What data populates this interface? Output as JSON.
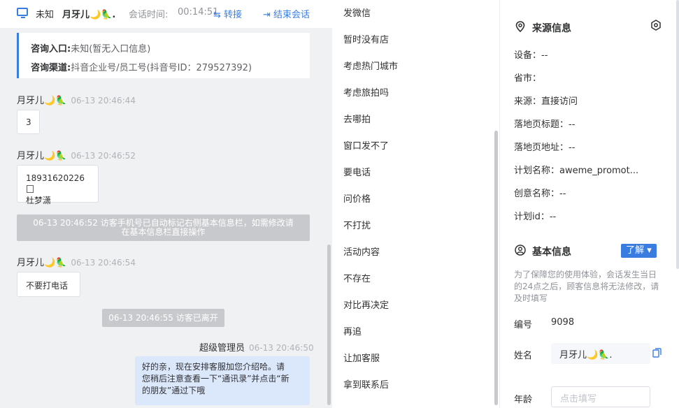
{
  "header": {
    "source": "未知",
    "name": "月牙儿🌙🦜.",
    "time_label": "会话时间:",
    "time": "00:14:51",
    "transfer": "⇆ 转接",
    "end": "⇥ 结束会话"
  },
  "consult": {
    "entry_label": "咨询入口:",
    "entry_value": "未知(暂无入口信息)",
    "channel_label": "咨询渠道:",
    "channel_value": "抖音企业号/员工号(抖音号ID：279527392)"
  },
  "messages": [
    {
      "sender": "月牙儿🌙🦜",
      "time": "06-13 20:46:44",
      "text": "3"
    },
    {
      "sender": "月牙儿🌙🦜",
      "time": "06-13 20:46:52",
      "line1": "18931620226",
      "line2": "杜梦潇"
    },
    {
      "sender": "月牙儿🌙🦜",
      "time": "06-13 20:46:54",
      "text": "不要打电话"
    }
  ],
  "system": [
    {
      "line1": "06-13 20:46:52 访客手机号已自动标记右侧基本信息栏，如需修改请",
      "line2": "在基本信息栏直接操作"
    },
    {
      "line1": "06-13 20:46:55 访客已离开"
    }
  ],
  "agent": {
    "sender": "超级管理员",
    "time": "06-13 20:46:50",
    "line1": "好的亲，现在安排客服加您介绍哈。请",
    "line2": "您稍后注意查看一下“通讯录”并点击“新",
    "line3": "的朋友”通过下哦"
  },
  "quick_replies": [
    "发微信",
    "暂时没有店",
    "考虑热门城市",
    "考虑旅拍吗",
    "去哪拍",
    "窗口发不了",
    "要电话",
    "问价格",
    "不打扰",
    "活动内容",
    "不存在",
    "对比再决定",
    "再追",
    "让加客服",
    "拿到联系后"
  ],
  "source_info": {
    "title": "来源信息",
    "rows": [
      "设备：--",
      "省市：",
      "来源：直接访问",
      "落地页标题：--",
      "落地页地址：--",
      "计划名称：aweme_promot...",
      "创意名称：--",
      "计划id：--"
    ]
  },
  "basic_info": {
    "title": "基本信息",
    "learn_btn": "了解 ▾",
    "notice": "为了保障您的使用体验，会话发生当日的24点之后，顾客信息将无法修改，请及时填写",
    "id_label": "编号",
    "id_value": "9098",
    "name_label": "姓名",
    "name_value": "月牙儿🌙🦜.",
    "age_label": "年龄",
    "age_placeholder": "点击填写"
  },
  "colors": {
    "accent": "#3a7de0",
    "chat_bg": "#f0f1f3",
    "agent_bubble": "#dbe7fb"
  }
}
